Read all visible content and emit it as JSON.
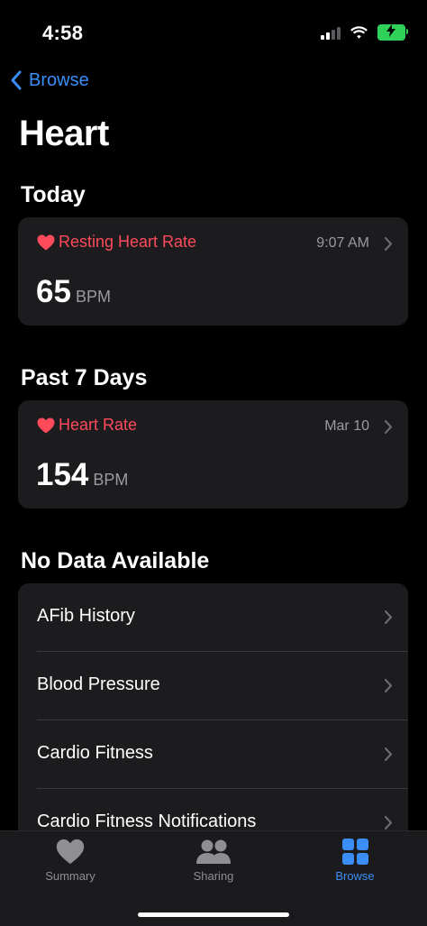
{
  "status_bar": {
    "time": "4:58"
  },
  "nav": {
    "back_label": "Browse"
  },
  "page": {
    "title": "Heart"
  },
  "today": {
    "section_title": "Today",
    "card": {
      "name": "Resting Heart Rate",
      "time": "9:07 AM",
      "value": "65",
      "unit": "BPM"
    }
  },
  "past7": {
    "section_title": "Past 7 Days",
    "card": {
      "name": "Heart Rate",
      "time": "Mar 10",
      "value": "154",
      "unit": "BPM"
    }
  },
  "no_data": {
    "section_title": "No Data Available",
    "items": [
      {
        "label": "AFib History"
      },
      {
        "label": "Blood Pressure"
      },
      {
        "label": "Cardio Fitness"
      },
      {
        "label": "Cardio Fitness Notifications"
      }
    ]
  },
  "tab_bar": {
    "tabs": [
      {
        "label": "Summary",
        "icon": "heart-icon"
      },
      {
        "label": "Sharing",
        "icon": "people-icon"
      },
      {
        "label": "Browse",
        "icon": "grid-icon",
        "active": true
      }
    ]
  },
  "colors": {
    "accent": "#3a8ef6",
    "heart": "#ff4a5c",
    "card": "#1c1c1e",
    "battery": "#2fd158"
  }
}
